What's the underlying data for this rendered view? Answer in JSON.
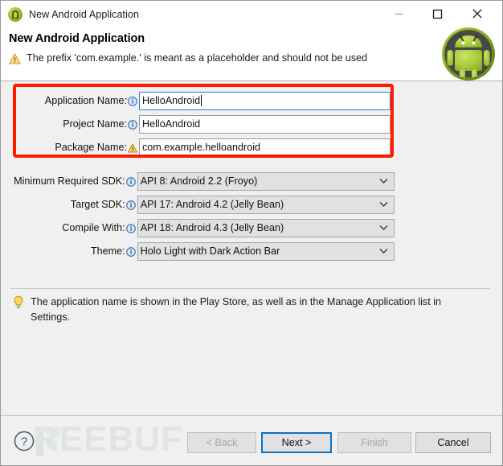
{
  "window": {
    "title": "New Android Application",
    "icon": "android-head-icon",
    "controls": {
      "minimize": "minimize-icon",
      "maximize": "maximize-icon",
      "close": "close-icon"
    }
  },
  "header": {
    "title": "New Android Application",
    "message": "The prefix 'com.example.' is meant as a placeholder and should not be used",
    "message_icon": "warning-triangle-icon",
    "banner_icon": "android-robot-icon"
  },
  "form": {
    "text_fields": [
      {
        "label": "Application Name:",
        "badge": "info-icon",
        "value": "HelloAndroid",
        "focused": true
      },
      {
        "label": "Project Name:",
        "badge": "info-icon",
        "value": "HelloAndroid",
        "focused": false
      },
      {
        "label": "Package Name:",
        "badge": "warning-icon",
        "value": "com.example.helloandroid",
        "focused": false
      }
    ],
    "combo_fields": [
      {
        "label": "Minimum Required SDK:",
        "badge": "info-icon",
        "value": "API 8: Android 2.2 (Froyo)"
      },
      {
        "label": "Target SDK:",
        "badge": "info-icon",
        "value": "API 17: Android 4.2 (Jelly Bean)"
      },
      {
        "label": "Compile With:",
        "badge": "info-icon",
        "value": "API 18: Android 4.3 (Jelly Bean)"
      },
      {
        "label": "Theme:",
        "badge": "info-icon",
        "value": "Holo Light with Dark Action Bar"
      }
    ],
    "highlight_color": "#ff1a00"
  },
  "hint": {
    "icon": "lightbulb-icon",
    "text": "The application name is shown in the Play Store, as well as in the Manage Application list in Settings."
  },
  "footer": {
    "help_icon": "help-question-icon",
    "watermark": "REEBUF",
    "watermark_mark": "freebuf-logo-icon",
    "buttons": [
      {
        "label": "< Back",
        "state": "disabled"
      },
      {
        "label": "Next >",
        "state": "default"
      },
      {
        "label": "Finish",
        "state": "disabled"
      },
      {
        "label": "Cancel",
        "state": "enabled"
      }
    ]
  }
}
